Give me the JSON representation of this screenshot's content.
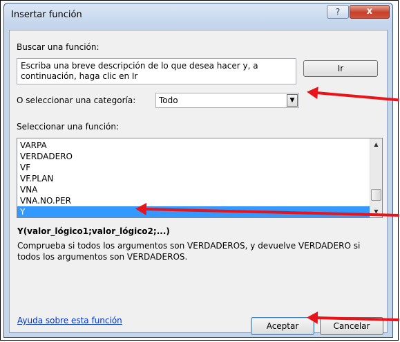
{
  "window": {
    "title": "Insertar función",
    "help_label": "?",
    "close_label": "x"
  },
  "search": {
    "label": "Buscar una función:",
    "value": "Escriba una breve descripción de lo que desea hacer y, a continuación, haga clic en Ir",
    "go_label": "Ir"
  },
  "category": {
    "label": "O seleccionar una categoría:",
    "value": "Todo"
  },
  "functions": {
    "label": "Seleccionar una función:",
    "items": [
      "VARPA",
      "VERDADERO",
      "VF",
      "VF.PLAN",
      "VNA",
      "VNA.NO.PER",
      "Y"
    ],
    "selected": "Y"
  },
  "details": {
    "signature": "Y(valor_lógico1;valor_lógico2;...)",
    "description": "Comprueba si todos los argumentos son VERDADEROS, y devuelve VERDADERO si todos los argumentos son VERDADEROS."
  },
  "footer": {
    "help_link": "Ayuda sobre esta función",
    "ok_label": "Aceptar",
    "cancel_label": "Cancelar"
  },
  "colors": {
    "annotation_arrow": "#e8141a",
    "selection": "#3399ff",
    "link": "#0033cc"
  }
}
